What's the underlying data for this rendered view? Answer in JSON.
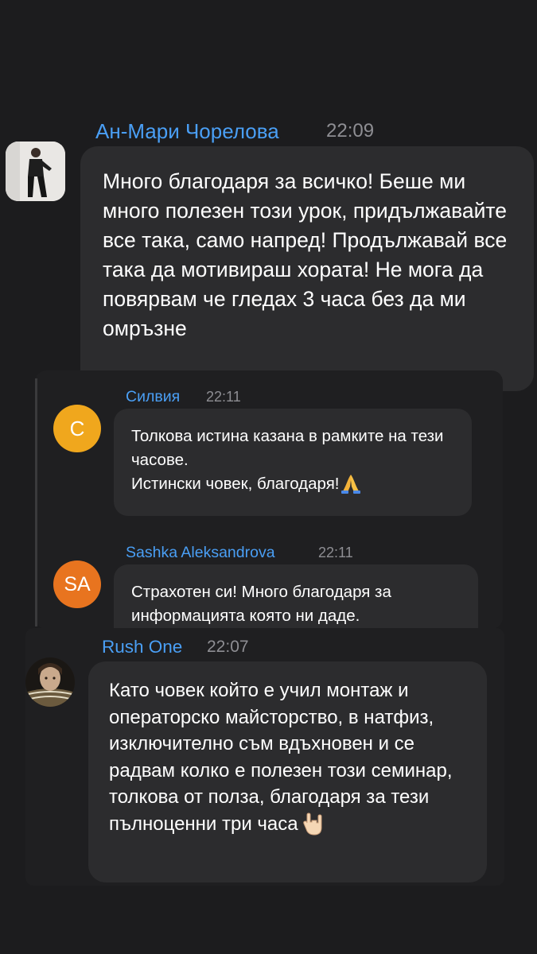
{
  "comments": [
    {
      "author": "Ан-Мари Чорелова",
      "time": "22:09",
      "text": "Много благодаря за всичко! Беше ми много полезен този урок, придължавайте все така, само напред! Продължавай все така да мотивираш хората! Не мога да повярвам че гледах 3 часа без да ми омръзне",
      "avatar": "photo"
    },
    {
      "author": "Силвия",
      "time": "22:11",
      "text_line1": "Толкова истина казана в рамките на тези часове.",
      "text_line2": "Истински човек, благодаря!",
      "avatar_letter": "С",
      "avatar_color": "#f0a71d",
      "emoji": "pray-emoji"
    },
    {
      "author": "Sashka Aleksandrova",
      "time": "22:11",
      "text": "Страхотен си! Много благодаря за информацията която ни даде.",
      "avatar_letter": "SA",
      "avatar_color": "#e8741f"
    },
    {
      "author": "Rush One",
      "time": "22:07",
      "text": "Като човек който е учил монтаж и операторско майсторство, в натфиз, изключително съм вдъхновен и се радвам колко е полезен този семинар, толкова от полза, благодаря за тези пълноценни три часа",
      "avatar": "photo",
      "emoji": "rock-hand-emoji"
    }
  ],
  "colors": {
    "background": "#1c1c1e",
    "bubble": "#2c2c2e",
    "name": "#4a9ff5",
    "time": "#8e8e93",
    "text": "#ffffff"
  }
}
